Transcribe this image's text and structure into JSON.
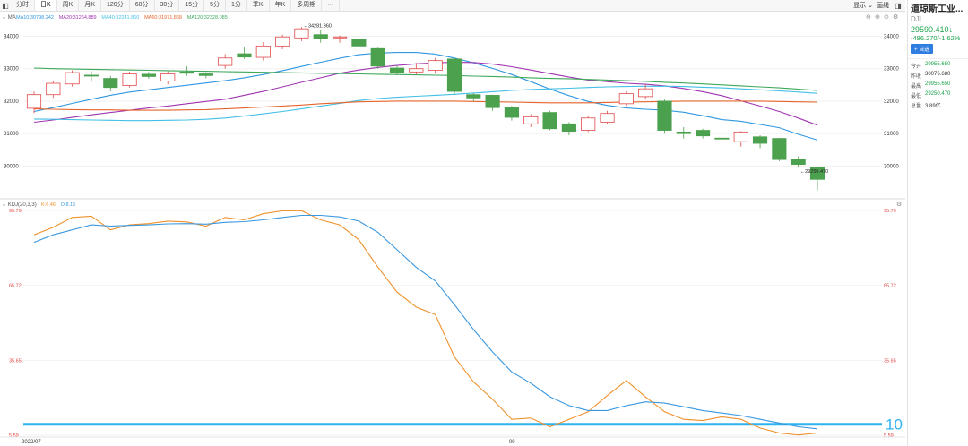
{
  "toolbar": {
    "tabs": [
      "分时",
      "日K",
      "周K",
      "月K",
      "120分",
      "60分",
      "30分",
      "15分",
      "5分",
      "1分",
      "季K",
      "年K",
      "多周期"
    ],
    "active": "日K",
    "more": "···",
    "display_label": "显示",
    "draw_label": "画线"
  },
  "sidebar": {
    "name": "道琼斯工业...",
    "code": "DJI",
    "price": "29590.410↓",
    "change": "-486.270/-1.62%",
    "add_label": "+ 自选",
    "rows": [
      {
        "k": "今开",
        "v": "29955.650",
        "neutral": false
      },
      {
        "k": "昨收",
        "v": "30076.680",
        "neutral": true
      },
      {
        "k": "最高",
        "v": "29955.650",
        "neutral": false
      },
      {
        "k": "最低",
        "v": "29250.470",
        "neutral": false
      },
      {
        "k": "总量",
        "v": "3.89亿",
        "neutral": true
      }
    ]
  },
  "colors": {
    "up": "#e24a4a",
    "down": "#4ba14e",
    "ma10": "#2f97e0",
    "ma20": "#a035b0",
    "ma40": "#43bfe6",
    "ma60": "#e6642a",
    "ma120": "#3ea85a",
    "k": "#f0902a",
    "d": "#3a98e0",
    "hline": "#2fb2f0"
  },
  "chart_data": [
    {
      "type": "candlestick",
      "title": "MA",
      "legend": [
        {
          "name": "MA10",
          "value": "30798.242"
        },
        {
          "name": "MA20",
          "value": "31264.889"
        },
        {
          "name": "MA40",
          "value": "32241.860"
        },
        {
          "name": "MA60",
          "value": "31971.868"
        },
        {
          "name": "MA120",
          "value": "32328.085"
        }
      ],
      "ylim": [
        29100,
        34400
      ],
      "yticks": [
        30000,
        31000,
        32000,
        33000,
        34000
      ],
      "xlabels": [
        {
          "index": 0,
          "label": "2022/07"
        },
        {
          "index": 25,
          "label": "09"
        }
      ],
      "annotations": [
        {
          "index": 14,
          "label": "←34281.360",
          "at": "high"
        },
        {
          "index": 40,
          "label": "←29250.470",
          "at": "low"
        }
      ],
      "candles": [
        {
          "o": 31780,
          "c": 32200,
          "h": 32300,
          "l": 31630
        },
        {
          "o": 32200,
          "c": 32550,
          "h": 32620,
          "l": 32100
        },
        {
          "o": 32530,
          "c": 32880,
          "h": 32950,
          "l": 32450
        },
        {
          "o": 32800,
          "c": 32780,
          "h": 32930,
          "l": 32600
        },
        {
          "o": 32700,
          "c": 32420,
          "h": 32780,
          "l": 32300
        },
        {
          "o": 32480,
          "c": 32840,
          "h": 32910,
          "l": 32420
        },
        {
          "o": 32830,
          "c": 32760,
          "h": 32900,
          "l": 32690
        },
        {
          "o": 32620,
          "c": 32840,
          "h": 32920,
          "l": 32520
        },
        {
          "o": 32900,
          "c": 32860,
          "h": 33080,
          "l": 32780
        },
        {
          "o": 32840,
          "c": 32790,
          "h": 32890,
          "l": 32700
        },
        {
          "o": 33100,
          "c": 33330,
          "h": 33450,
          "l": 33000
        },
        {
          "o": 33460,
          "c": 33360,
          "h": 33680,
          "l": 33300
        },
        {
          "o": 33350,
          "c": 33700,
          "h": 33820,
          "l": 33250
        },
        {
          "o": 33700,
          "c": 33980,
          "h": 34050,
          "l": 33600
        },
        {
          "o": 33950,
          "c": 34230,
          "h": 34281,
          "l": 33850
        },
        {
          "o": 34050,
          "c": 33920,
          "h": 34200,
          "l": 33800
        },
        {
          "o": 33950,
          "c": 33980,
          "h": 34020,
          "l": 33800
        },
        {
          "o": 33920,
          "c": 33700,
          "h": 34000,
          "l": 33620
        },
        {
          "o": 33620,
          "c": 33080,
          "h": 33650,
          "l": 33000
        },
        {
          "o": 33020,
          "c": 32880,
          "h": 33100,
          "l": 32800
        },
        {
          "o": 32900,
          "c": 33000,
          "h": 33180,
          "l": 32820
        },
        {
          "o": 32950,
          "c": 33250,
          "h": 33330,
          "l": 32850
        },
        {
          "o": 33300,
          "c": 32300,
          "h": 33320,
          "l": 32200
        },
        {
          "o": 32200,
          "c": 32100,
          "h": 32250,
          "l": 32000
        },
        {
          "o": 32180,
          "c": 31800,
          "h": 32200,
          "l": 31700
        },
        {
          "o": 31800,
          "c": 31500,
          "h": 31850,
          "l": 31400
        },
        {
          "o": 31300,
          "c": 31520,
          "h": 31600,
          "l": 31200
        },
        {
          "o": 31650,
          "c": 31150,
          "h": 31700,
          "l": 31100
        },
        {
          "o": 31300,
          "c": 31070,
          "h": 31350,
          "l": 30950
        },
        {
          "o": 31100,
          "c": 31480,
          "h": 31550,
          "l": 31050
        },
        {
          "o": 31350,
          "c": 31620,
          "h": 31700,
          "l": 31300
        },
        {
          "o": 31920,
          "c": 32230,
          "h": 32300,
          "l": 31850
        },
        {
          "o": 32140,
          "c": 32380,
          "h": 32500,
          "l": 32060
        },
        {
          "o": 32000,
          "c": 31100,
          "h": 32050,
          "l": 31000
        },
        {
          "o": 31050,
          "c": 31000,
          "h": 31200,
          "l": 30850
        },
        {
          "o": 31100,
          "c": 30930,
          "h": 31150,
          "l": 30850
        },
        {
          "o": 30860,
          "c": 30840,
          "h": 30950,
          "l": 30600
        },
        {
          "o": 30750,
          "c": 31050,
          "h": 31080,
          "l": 30600
        },
        {
          "o": 30900,
          "c": 30700,
          "h": 30950,
          "l": 30550
        },
        {
          "o": 30850,
          "c": 30200,
          "h": 30870,
          "l": 30150
        },
        {
          "o": 30200,
          "c": 30050,
          "h": 30300,
          "l": 29950
        },
        {
          "o": 29960,
          "c": 29590,
          "h": 29960,
          "l": 29250
        }
      ],
      "series": [
        {
          "name": "MA10",
          "values": [
            31680,
            31800,
            31930,
            32060,
            32180,
            32280,
            32350,
            32420,
            32490,
            32560,
            32630,
            32720,
            32820,
            32940,
            33070,
            33200,
            33320,
            33430,
            33480,
            33500,
            33500,
            33450,
            33330,
            33180,
            33010,
            32820,
            32600,
            32370,
            32170,
            31990,
            31870,
            31790,
            31750,
            31720,
            31660,
            31550,
            31430,
            31380,
            31280,
            31180,
            30980,
            30800
          ]
        },
        {
          "name": "MA20",
          "values": [
            31350,
            31420,
            31500,
            31580,
            31650,
            31720,
            31790,
            31850,
            31920,
            31990,
            32060,
            32180,
            32300,
            32440,
            32580,
            32720,
            32860,
            32960,
            33040,
            33100,
            33150,
            33180,
            33200,
            33190,
            33140,
            33060,
            32960,
            32850,
            32740,
            32650,
            32600,
            32550,
            32520,
            32470,
            32390,
            32290,
            32170,
            32010,
            31850,
            31680,
            31480,
            31260
          ]
        },
        {
          "name": "MA40",
          "values": [
            31450,
            31440,
            31430,
            31420,
            31410,
            31400,
            31400,
            31410,
            31420,
            31440,
            31480,
            31540,
            31610,
            31680,
            31760,
            31850,
            31930,
            32020,
            32080,
            32120,
            32150,
            32180,
            32210,
            32250,
            32290,
            32330,
            32360,
            32380,
            32400,
            32420,
            32440,
            32450,
            32460,
            32460,
            32450,
            32430,
            32410,
            32380,
            32350,
            32320,
            32280,
            32240
          ]
        },
        {
          "name": "MA60",
          "values": [
            31760,
            31750,
            31740,
            31730,
            31730,
            31720,
            31720,
            31720,
            31730,
            31740,
            31760,
            31790,
            31820,
            31850,
            31880,
            31920,
            31950,
            31980,
            31990,
            32000,
            32000,
            32000,
            32000,
            31990,
            31980,
            31970,
            31960,
            31950,
            31950,
            31950,
            31960,
            31970,
            31980,
            31990,
            32000,
            32000,
            32000,
            32000,
            32000,
            31990,
            31980,
            31970
          ]
        },
        {
          "name": "MA120",
          "values": [
            33020,
            33000,
            32990,
            32980,
            32970,
            32960,
            32950,
            32940,
            32930,
            32920,
            32910,
            32900,
            32890,
            32880,
            32870,
            32860,
            32850,
            32840,
            32830,
            32820,
            32810,
            32800,
            32790,
            32770,
            32760,
            32740,
            32720,
            32700,
            32690,
            32670,
            32650,
            32630,
            32610,
            32580,
            32560,
            32530,
            32500,
            32470,
            32440,
            32410,
            32370,
            32330
          ]
        }
      ]
    },
    {
      "type": "line",
      "title": "KDJ(20,3,3)",
      "legend": [
        {
          "name": "K",
          "value": "6.46"
        },
        {
          "name": "D",
          "value": "8.16"
        }
      ],
      "ylim": [
        5.59,
        95.79
      ],
      "yticks": [
        "95.79",
        "65.72",
        "35.65",
        "5.59"
      ],
      "hline": {
        "value": 10,
        "label": "10"
      },
      "series": [
        {
          "name": "K",
          "values": [
            86,
            89,
            93,
            93.5,
            88,
            90,
            90.5,
            91.5,
            91.2,
            89.5,
            93,
            92,
            94.5,
            95.6,
            95.7,
            92,
            90,
            84,
            73,
            63,
            57,
            54,
            37,
            27,
            20,
            12,
            12.5,
            9,
            12,
            15,
            21.5,
            27.5,
            21,
            15,
            12,
            11.5,
            13,
            12,
            8.5,
            6.5,
            5.7,
            6.5
          ]
        },
        {
          "name": "D",
          "values": [
            83,
            86,
            88,
            90,
            89.5,
            89.8,
            90,
            90.4,
            90.5,
            90.3,
            91,
            91.3,
            92,
            93,
            93.8,
            93.8,
            93.2,
            91.5,
            87,
            80,
            73,
            67.5,
            58,
            48,
            39,
            31,
            26.5,
            21,
            17.5,
            15.5,
            15.5,
            17.5,
            19,
            18.5,
            17,
            15.5,
            14.5,
            13.5,
            12,
            10.5,
            9,
            8.16
          ]
        }
      ]
    }
  ]
}
